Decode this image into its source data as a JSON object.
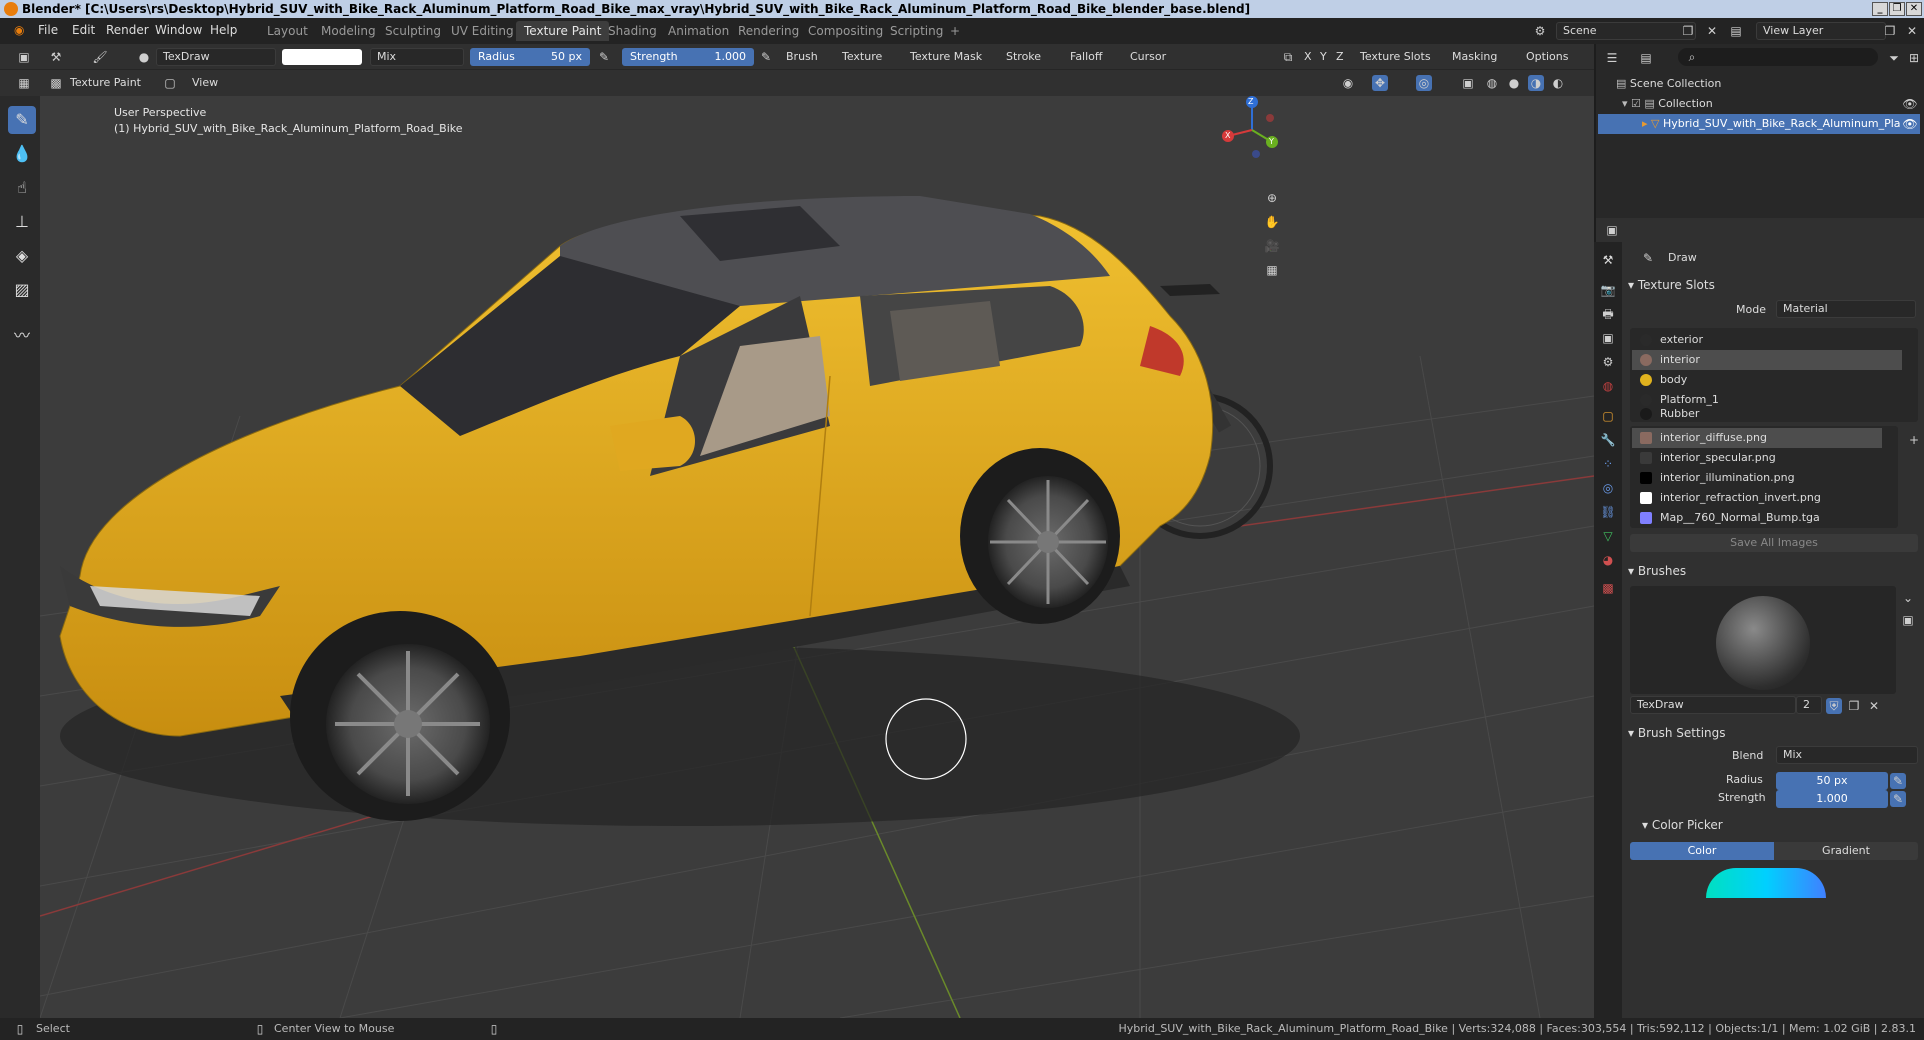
{
  "window": {
    "title": "Blender* [C:\\Users\\rs\\Desktop\\Hybrid_SUV_with_Bike_Rack_Aluminum_Platform_Road_Bike_max_vray\\Hybrid_SUV_with_Bike_Rack_Aluminum_Platform_Road_Bike_blender_base.blend]"
  },
  "menubar": {
    "menus": [
      "File",
      "Edit",
      "Render",
      "Window",
      "Help"
    ],
    "workspaces": [
      "Layout",
      "Modeling",
      "Sculpting",
      "UV Editing",
      "Texture Paint",
      "Shading",
      "Animation",
      "Rendering",
      "Compositing",
      "Scripting"
    ],
    "active_workspace": "Texture Paint",
    "add_tab": "+",
    "scene": "Scene",
    "view_layer": "View Layer"
  },
  "tool_header": {
    "brush_name": "TexDraw",
    "blend": "Mix",
    "radius_label": "Radius",
    "radius_value": "50 px",
    "strength_label": "Strength",
    "strength_value": "1.000",
    "menus": [
      "Brush",
      "Texture",
      "Texture Mask",
      "Stroke",
      "Falloff",
      "Cursor"
    ],
    "axes": [
      "X",
      "Y",
      "Z"
    ],
    "right_menus": [
      "Texture Slots",
      "Masking",
      "Options"
    ]
  },
  "view_header": {
    "mode": "Texture Paint",
    "view_menu": "View"
  },
  "viewport": {
    "perspective": "User Perspective",
    "object": "(1) Hybrid_SUV_with_Bike_Rack_Aluminum_Platform_Road_Bike",
    "gizmo_axes": [
      "X",
      "Y",
      "Z"
    ]
  },
  "outliner": {
    "scene_collection": "Scene Collection",
    "collection": "Collection",
    "object": "Hybrid_SUV_with_Bike_Rack_Aluminum_Pla"
  },
  "properties": {
    "tool_name": "Draw",
    "texture_slots_title": "Texture Slots",
    "mode_label": "Mode",
    "mode_value": "Material",
    "materials": [
      {
        "name": "exterior",
        "color": "#2a2a2a"
      },
      {
        "name": "interior",
        "color": "#8a6a60"
      },
      {
        "name": "body",
        "color": "#e0b21e"
      },
      {
        "name": "Platform_1",
        "color": "#2a2a2a"
      },
      {
        "name": "Rubber",
        "color": "#1a1a1a"
      }
    ],
    "selected_material": "interior",
    "images": [
      {
        "name": "interior_diffuse.png",
        "color": "#8a6a60"
      },
      {
        "name": "interior_specular.png",
        "color": "#3a3a3a"
      },
      {
        "name": "interior_illumination.png",
        "color": "#000000"
      },
      {
        "name": "interior_refraction_invert.png",
        "color": "#ffffff"
      },
      {
        "name": "Map__760_Normal_Bump.tga",
        "color": "#8080ff"
      }
    ],
    "selected_image": "interior_diffuse.png",
    "save_all_images": "Save All Images",
    "brushes_title": "Brushes",
    "brush_name": "TexDraw",
    "brush_users": "2",
    "brush_settings_title": "Brush Settings",
    "blend_label": "Blend",
    "blend_value": "Mix",
    "radius_label": "Radius",
    "radius_value": "50 px",
    "strength_label": "Strength",
    "strength_value": "1.000",
    "color_picker_title": "Color Picker",
    "color_tab": "Color",
    "gradient_tab": "Gradient"
  },
  "statusbar": {
    "select": "Select",
    "center_view": "Center View to Mouse",
    "stats": "Hybrid_SUV_with_Bike_Rack_Aluminum_Platform_Road_Bike | Verts:324,088 | Faces:303,554 | Tris:592,112 | Objects:1/1 | Mem: 1.02 GiB | 2.83.1"
  },
  "colors": {
    "accent": "#4772b3",
    "car_body": "#e0a820",
    "bike_frame": "#8a4fc9",
    "brush_cursor": "#ffffff"
  }
}
